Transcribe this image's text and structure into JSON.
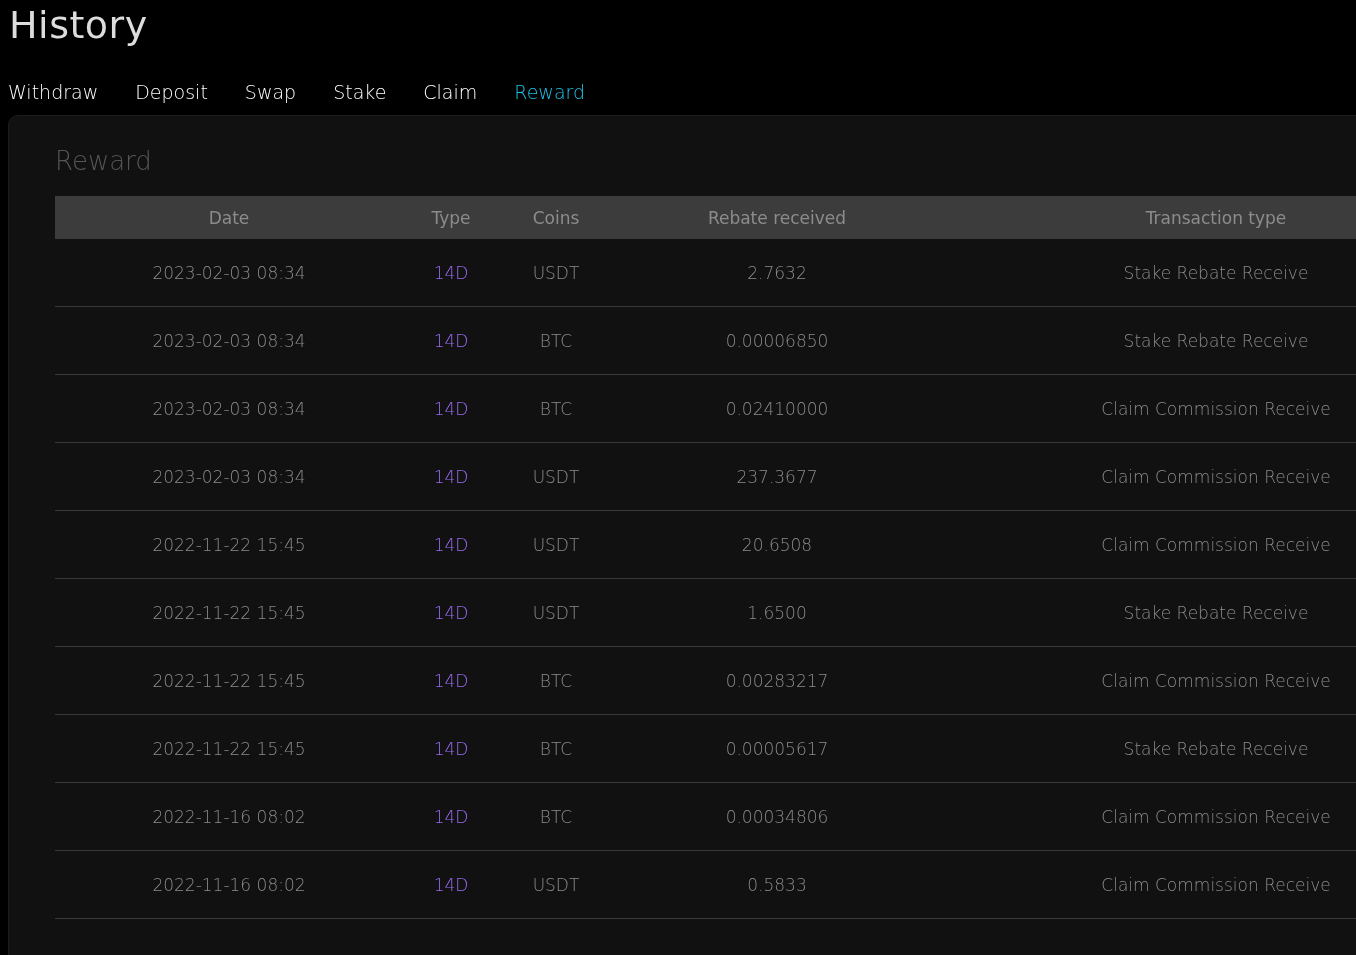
{
  "page": {
    "title": "History"
  },
  "tabs": [
    {
      "label": "Withdraw",
      "selected": false
    },
    {
      "label": "Deposit",
      "selected": false
    },
    {
      "label": "Swap",
      "selected": false
    },
    {
      "label": "Stake",
      "selected": false
    },
    {
      "label": "Claim",
      "selected": false
    },
    {
      "label": "Reward",
      "selected": true
    }
  ],
  "panel": {
    "title": "Reward"
  },
  "table": {
    "columns": [
      "Date",
      "Type",
      "Coins",
      "Rebate received",
      "Transaction type"
    ],
    "rows": [
      [
        "2023-02-03 08:34",
        "14D",
        "USDT",
        "2.7632",
        "Stake Rebate Receive"
      ],
      [
        "2023-02-03 08:34",
        "14D",
        "BTC",
        "0.00006850",
        "Stake Rebate Receive"
      ],
      [
        "2023-02-03 08:34",
        "14D",
        "BTC",
        "0.02410000",
        "Claim Commission Receive"
      ],
      [
        "2023-02-03 08:34",
        "14D",
        "USDT",
        "237.3677",
        "Claim Commission Receive"
      ],
      [
        "2022-11-22 15:45",
        "14D",
        "USDT",
        "20.6508",
        "Claim Commission Receive"
      ],
      [
        "2022-11-22 15:45",
        "14D",
        "USDT",
        "1.6500",
        "Stake Rebate Receive"
      ],
      [
        "2022-11-22 15:45",
        "14D",
        "BTC",
        "0.00283217",
        "Claim Commission Receive"
      ],
      [
        "2022-11-22 15:45",
        "14D",
        "BTC",
        "0.00005617",
        "Stake Rebate Receive"
      ],
      [
        "2022-11-16 08:02",
        "14D",
        "BTC",
        "0.00034806",
        "Claim Commission Receive"
      ],
      [
        "2022-11-16 08:02",
        "14D",
        "USDT",
        "0.5833",
        "Claim Commission Receive"
      ]
    ]
  }
}
